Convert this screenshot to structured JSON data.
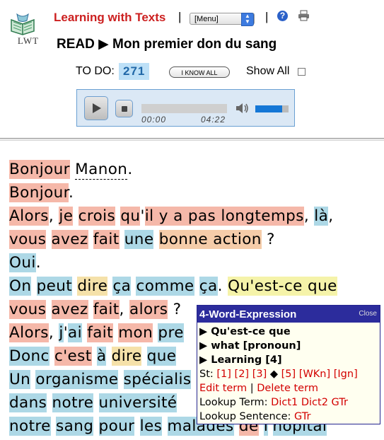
{
  "header": {
    "app_title": "Learning with Texts",
    "logo_text": "LWT",
    "separator": "|",
    "menu_select_value": "[Menu]",
    "read_label": "READ",
    "read_arrow": "▶",
    "text_title": "Mon premier don du sang",
    "todo_label": "TO DO:",
    "todo_count": "271",
    "know_all_button": "I KNOW ALL",
    "show_all_label": "Show All",
    "show_all_checked": false,
    "icons": {
      "help": "help-question-icon",
      "print": "printer-icon"
    }
  },
  "player": {
    "time_current": "00:00",
    "time_total": "04:22",
    "volume_level": 0.8,
    "icons": {
      "play": "play-icon",
      "stop": "stop-icon",
      "volume": "speaker-volume-icon"
    }
  },
  "text": {
    "lines": [
      [
        {
          "t": "Bonjour",
          "s": "s1"
        },
        {
          "t": " "
        },
        {
          "t": "Manon",
          "s": "unk"
        },
        {
          "t": "."
        }
      ],
      [
        {
          "t": "Bonjour",
          "s": "s1"
        },
        {
          "t": "."
        }
      ],
      [
        {
          "t": "Alors",
          "s": "s1"
        },
        {
          "t": ", "
        },
        {
          "t": "je",
          "s": "s1"
        },
        {
          "t": " "
        },
        {
          "t": "crois",
          "s": "s1"
        },
        {
          "t": " "
        },
        {
          "t": "qu",
          "s": "s1"
        },
        {
          "t": "'"
        },
        {
          "t": "il y a pas longtemps",
          "s": "s1"
        },
        {
          "t": ", "
        },
        {
          "t": "là",
          "s": "s0"
        },
        {
          "t": ","
        }
      ],
      [
        {
          "t": "vous",
          "s": "s1"
        },
        {
          "t": " "
        },
        {
          "t": "avez",
          "s": "s1"
        },
        {
          "t": " "
        },
        {
          "t": "fait",
          "s": "s1"
        },
        {
          "t": " "
        },
        {
          "t": "une",
          "s": "s0"
        },
        {
          "t": " "
        },
        {
          "t": "bonne action",
          "s": "s2"
        },
        {
          "t": " ?"
        }
      ],
      [
        {
          "t": "Oui",
          "s": "s0"
        },
        {
          "t": "."
        }
      ],
      [
        {
          "t": "On",
          "s": "s0"
        },
        {
          "t": " "
        },
        {
          "t": "peut",
          "s": "s0"
        },
        {
          "t": " "
        },
        {
          "t": "dire",
          "s": "s3"
        },
        {
          "t": " "
        },
        {
          "t": "ça",
          "s": "s0"
        },
        {
          "t": " "
        },
        {
          "t": "comme",
          "s": "s0"
        },
        {
          "t": " "
        },
        {
          "t": "ça",
          "s": "s0"
        },
        {
          "t": ". "
        },
        {
          "t": "Qu'est-ce que",
          "s": "s4"
        }
      ],
      [
        {
          "t": "vous",
          "s": "s1"
        },
        {
          "t": " "
        },
        {
          "t": "avez",
          "s": "s1"
        },
        {
          "t": " "
        },
        {
          "t": "fait",
          "s": "s1"
        },
        {
          "t": ", "
        },
        {
          "t": "alors",
          "s": "s1"
        },
        {
          "t": " ? "
        }
      ],
      [
        {
          "t": "Alors",
          "s": "s1"
        },
        {
          "t": ", "
        },
        {
          "t": "j",
          "s": "s0"
        },
        {
          "t": "'"
        },
        {
          "t": "ai",
          "s": "s0"
        },
        {
          "t": " "
        },
        {
          "t": "fait",
          "s": "s1"
        },
        {
          "t": " "
        },
        {
          "t": "mon",
          "s": "s1"
        },
        {
          "t": " "
        },
        {
          "t": "pre",
          "s": "s0"
        }
      ],
      [
        {
          "t": "Donc",
          "s": "s0"
        },
        {
          "t": " "
        },
        {
          "t": "c'est",
          "s": "s1"
        },
        {
          "t": " "
        },
        {
          "t": "à",
          "s": "s0"
        },
        {
          "t": " "
        },
        {
          "t": "dire",
          "s": "s3"
        },
        {
          "t": " "
        },
        {
          "t": "que",
          "s": "s0"
        }
      ],
      [
        {
          "t": "Un",
          "s": "s0"
        },
        {
          "t": " "
        },
        {
          "t": "organisme",
          "s": "s0"
        },
        {
          "t": " "
        },
        {
          "t": "spécialis",
          "s": "s0"
        }
      ],
      [
        {
          "t": "dans",
          "s": "s0"
        },
        {
          "t": " "
        },
        {
          "t": "notre",
          "s": "s0"
        },
        {
          "t": " "
        },
        {
          "t": "université",
          "s": "s0"
        }
      ],
      [
        {
          "t": "notre",
          "s": "s0"
        },
        {
          "t": " "
        },
        {
          "t": "sang",
          "s": "s0"
        },
        {
          "t": " "
        },
        {
          "t": "pour",
          "s": "s0"
        },
        {
          "t": " "
        },
        {
          "t": "les",
          "s": "s0"
        },
        {
          "t": " "
        },
        {
          "t": "malades",
          "s": "s0"
        },
        {
          "t": " "
        },
        {
          "t": "de",
          "s": "s1"
        },
        {
          "t": " "
        },
        {
          "t": "l",
          "s": "s0"
        },
        {
          "t": "'"
        },
        {
          "t": "hôpital",
          "s": "s0"
        }
      ]
    ]
  },
  "popup": {
    "title": "4-Word-Expression",
    "close_label": "Close",
    "term_line": "▶ Qu'est-ce que",
    "translation_line": "▶ what [pronoun]",
    "status_line": "▶ Learning [4]",
    "status_label": "St:",
    "status_links": [
      "[1]",
      "[2]",
      "[3]",
      "◆",
      "[5]",
      "[WKn]",
      "[Ign]"
    ],
    "edit_term": "Edit term",
    "delete_term": "Delete term",
    "link_separator": "|",
    "lookup_term_label": "Lookup Term:",
    "lookup_term_links": [
      "Dict1",
      "Dict2",
      "GTr"
    ],
    "lookup_sentence_label": "Lookup Sentence:",
    "lookup_sentence_links": [
      "GTr"
    ]
  }
}
